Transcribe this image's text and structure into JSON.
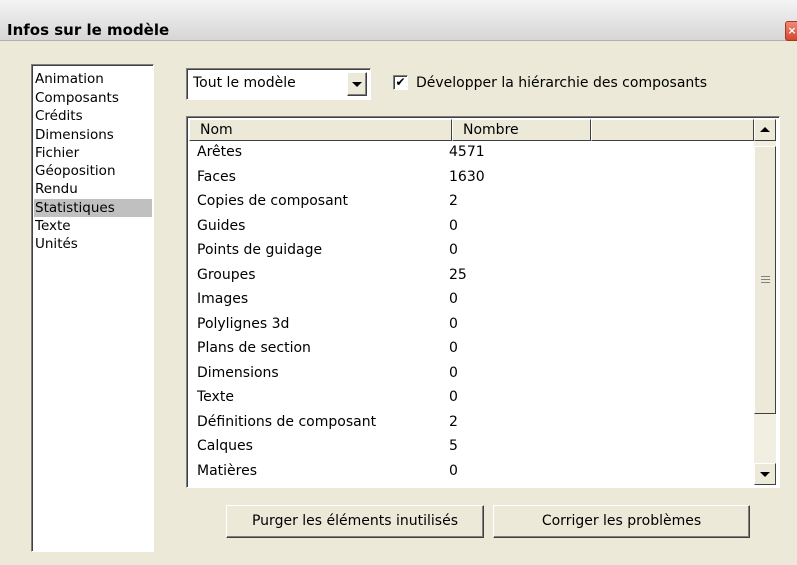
{
  "window": {
    "title": "Infos sur le modèle",
    "close": "×"
  },
  "sidebar": {
    "items": [
      {
        "label": "Animation"
      },
      {
        "label": "Composants"
      },
      {
        "label": "Crédits"
      },
      {
        "label": "Dimensions"
      },
      {
        "label": "Fichier"
      },
      {
        "label": "Géoposition"
      },
      {
        "label": "Rendu"
      },
      {
        "label": "Statistiques",
        "selected": true
      },
      {
        "label": "Texte"
      },
      {
        "label": "Unités"
      }
    ]
  },
  "scope_select": {
    "value": "Tout le modèle"
  },
  "expand_checkbox": {
    "checked": true,
    "mark": "✔",
    "label": "Développer la hiérarchie des composants"
  },
  "table": {
    "columns": [
      "Nom",
      "Nombre",
      ""
    ],
    "rows": [
      {
        "name": "Arêtes",
        "count": "4571"
      },
      {
        "name": "Faces",
        "count": "1630"
      },
      {
        "name": "Copies de composant",
        "count": "2"
      },
      {
        "name": "Guides",
        "count": "0"
      },
      {
        "name": "Points de guidage",
        "count": "0"
      },
      {
        "name": "Groupes",
        "count": "25"
      },
      {
        "name": "Images",
        "count": "0"
      },
      {
        "name": "Polylignes 3d",
        "count": "0"
      },
      {
        "name": "Plans de section",
        "count": "0"
      },
      {
        "name": "Dimensions",
        "count": "0"
      },
      {
        "name": "Texte",
        "count": "0"
      },
      {
        "name": "Définitions de composant",
        "count": "2"
      },
      {
        "name": "Calques",
        "count": "5"
      },
      {
        "name": "Matières",
        "count": "0"
      }
    ]
  },
  "buttons": {
    "purge": "Purger les éléments inutilisés",
    "fix": "Corriger les problèmes"
  }
}
